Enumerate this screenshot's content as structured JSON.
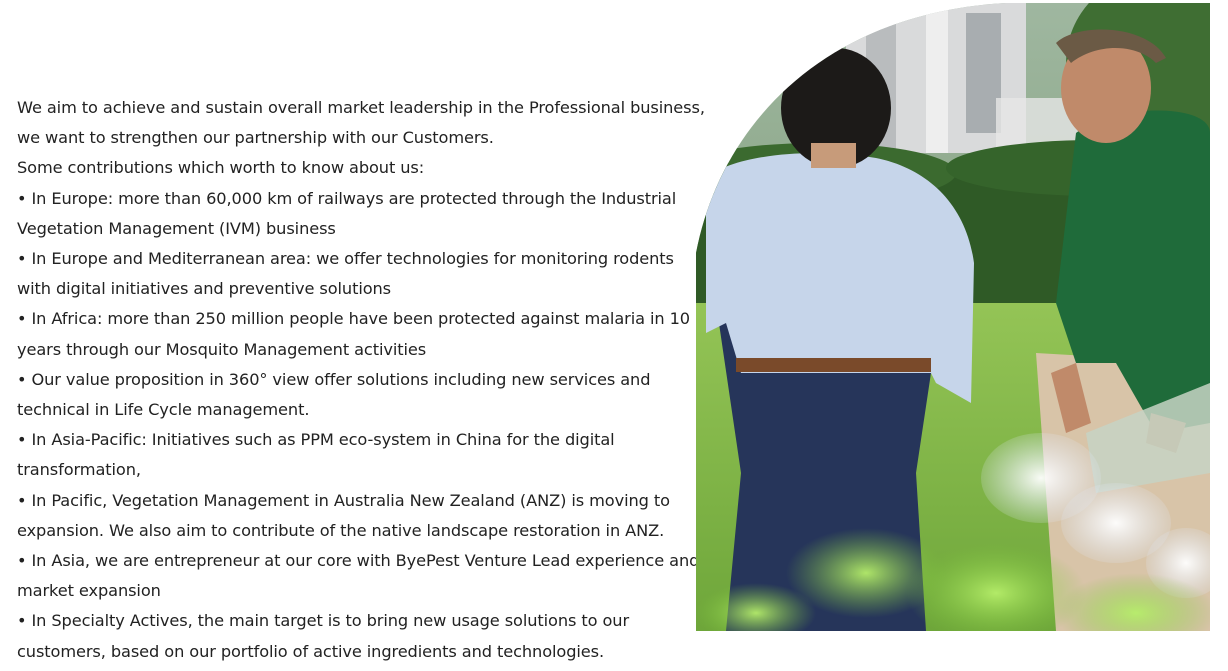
{
  "content": {
    "paragraphs": [
      "We aim to achieve and sustain overall market leadership in the Professional business, we want to strengthen our partnership with our Customers.",
      "Some contributions which worth to know about us:",
      "• In Europe: more than 60,000 km of railways are protected through the Industrial Vegetation Management (IVM) business",
      "• In Europe and Mediterranean area: we offer technologies for monitoring rodents with digital initiatives and preventive solutions",
      "• In Africa: more than 250 million people have been protected against malaria in 10 years through our Mosquito Management activities",
      "• Our value proposition in 360° view offer solutions including new services and technical in Life Cycle management.",
      "• In Asia-Pacific: Initiatives such as PPM eco-system in China for the digital transformation,",
      "• In Pacific, Vegetation Management in Australia New Zealand (ANZ) is moving to expansion. We also aim to contribute of the native landscape restoration in ANZ.",
      "• In Asia, we are entrepreneur at our core with ByePest Venture Lead experience and market expansion",
      "• In Specialty Actives, the main target is to bring new usage solutions to our customers, based on our portfolio of active ingredients and technologies."
    ]
  },
  "photo": {
    "subject": "two-men-walking-on-lawn"
  },
  "colors": {
    "text": "#222222",
    "background": "#ffffff",
    "grass": "#7fb84a",
    "hedge": "#2f5a26",
    "green_shirt": "#1f6b3a",
    "blue_shirt": "#c6d5ea",
    "navy_trousers": "#26355a"
  }
}
